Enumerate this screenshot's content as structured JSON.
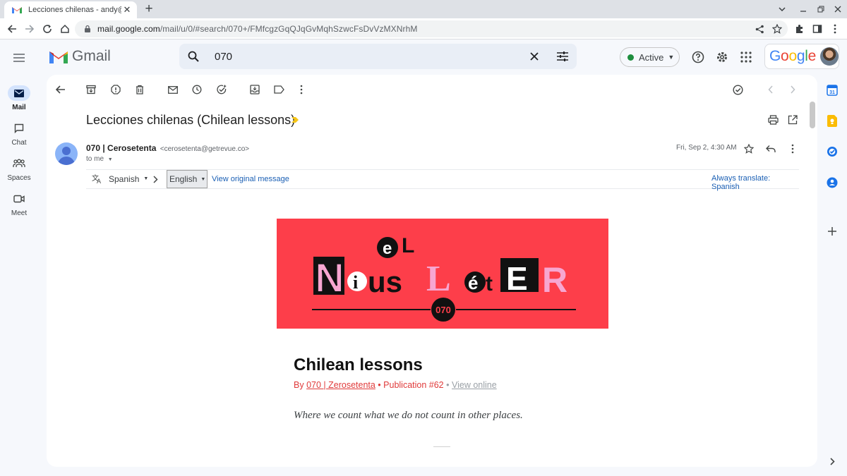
{
  "browser": {
    "tab_title": "Lecciones chilenas - andy@wolb",
    "url_host": "mail.google.com",
    "url_path": "/mail/u/0/#search/070+/FMfcgzGqQJqGvMqhSzwcFsDvVzMXNrhM",
    "new_tab": "+",
    "close_tab": "✕"
  },
  "gmail": {
    "brand": "Gmail",
    "search_query": "070",
    "status": "Active",
    "google_word": [
      "G",
      "o",
      "o",
      "g",
      "l",
      "e"
    ],
    "google_colors": [
      "#4285f4",
      "#ea4335",
      "#fbbc05",
      "#4285f4",
      "#34a853",
      "#ea4335"
    ],
    "accent": "#0b57d0"
  },
  "rail": {
    "items": [
      {
        "label": "Mail"
      },
      {
        "label": "Chat"
      },
      {
        "label": "Spaces"
      },
      {
        "label": "Meet"
      }
    ]
  },
  "message": {
    "subject": "Lecciones chilenas (Chilean lessons)",
    "sender_name": "070 | Cerosetenta",
    "sender_email": "<cerosetenta@getrevue.co>",
    "to": "to me",
    "date": "Fri, Sep 2, 4:30 AM"
  },
  "translate": {
    "source_lang": "Spanish",
    "target_lang": "English",
    "view_original": "View original message",
    "always_translate": "Always translate: Spanish"
  },
  "newsletter": {
    "logo_top": "eL",
    "logo_main": "NiusLétER",
    "logo_badge": "070",
    "title": "Chilean lessons",
    "by_prefix": "By ",
    "author": "070 | Zerosetenta",
    "publication": " • Publication #62 ",
    "dot": "•",
    "view_online": "View online",
    "quote": "Where we count what we do not count in other places.",
    "banner_color": "#fd3e4a"
  }
}
